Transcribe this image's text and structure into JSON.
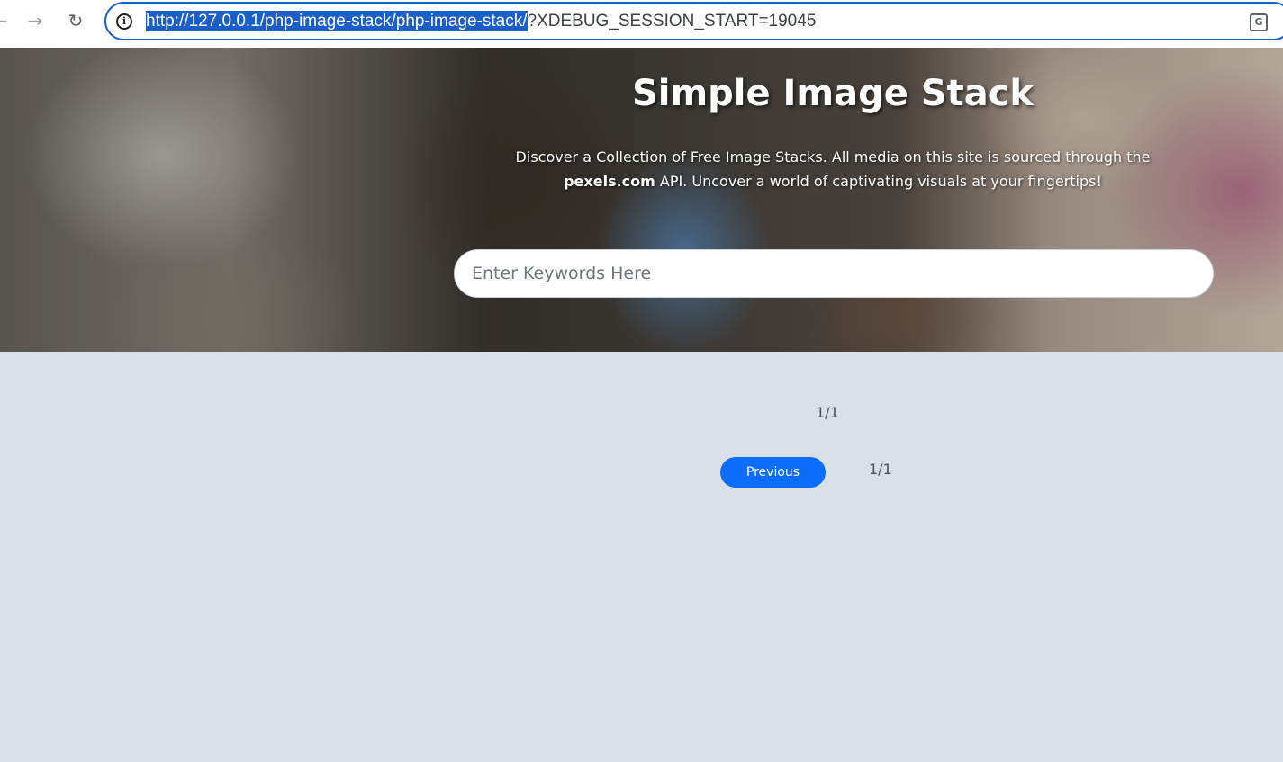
{
  "browser": {
    "url_selected": "http://127.0.0.1/php-image-stack/php-image-stack/",
    "url_rest": "?XDEBUG_SESSION_START=19045"
  },
  "hero": {
    "title": "Simple Image Stack",
    "description_part1": "Discover a Collection of Free Image Stacks. All media on this site is sourced through the",
    "description_brand": "pexels.com",
    "description_part2": "API. Uncover a world of captivating visuals at your fingertips!",
    "search_placeholder": "Enter Keywords Here"
  },
  "pagination": {
    "page_indicator_top": "1/1",
    "previous_label": "Previous",
    "page_indicator_bottom": "1/1"
  },
  "colors": {
    "accent": "#0d6efd",
    "omnibox_border": "#1a5fc8",
    "page_background": "#d9e0e7"
  }
}
